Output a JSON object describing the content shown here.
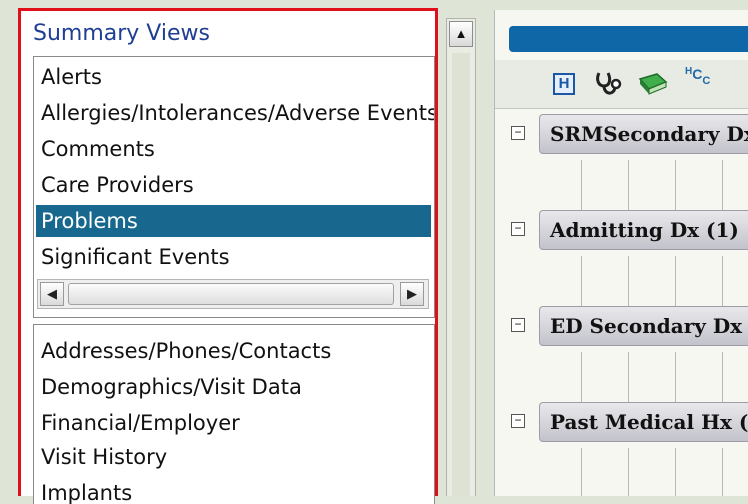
{
  "summary_views": {
    "title": "Summary Views",
    "top_items": [
      {
        "label": "Alerts"
      },
      {
        "label": "Allergies/Intolerances/Adverse Events"
      },
      {
        "label": "Comments"
      },
      {
        "label": "Care Providers"
      },
      {
        "label": "Problems",
        "selected": true
      },
      {
        "label": "Significant Events"
      }
    ],
    "bottom_items": [
      {
        "label": "Addresses/Phones/Contacts"
      },
      {
        "label": "Demographics/Visit Data"
      },
      {
        "label": "Financial/Employer"
      },
      {
        "label": "Visit History"
      },
      {
        "label": "Implants"
      }
    ]
  },
  "toolbar": {
    "icons": [
      "h-icon",
      "stethoscope-icon",
      "book-icon",
      "hcc-icon"
    ],
    "h_label": "H",
    "hcc_label": "HCC"
  },
  "sections": [
    {
      "label": "SRMSecondary Dx"
    },
    {
      "label": "Admitting Dx (1)"
    },
    {
      "label": "ED Secondary Dx"
    },
    {
      "label": "Past Medical Hx ("
    }
  ],
  "colors": {
    "frame_red": "#e0101a",
    "selection_blue": "#17678f",
    "title_blue": "#1f3f95",
    "bar_blue": "#0f67a8"
  }
}
